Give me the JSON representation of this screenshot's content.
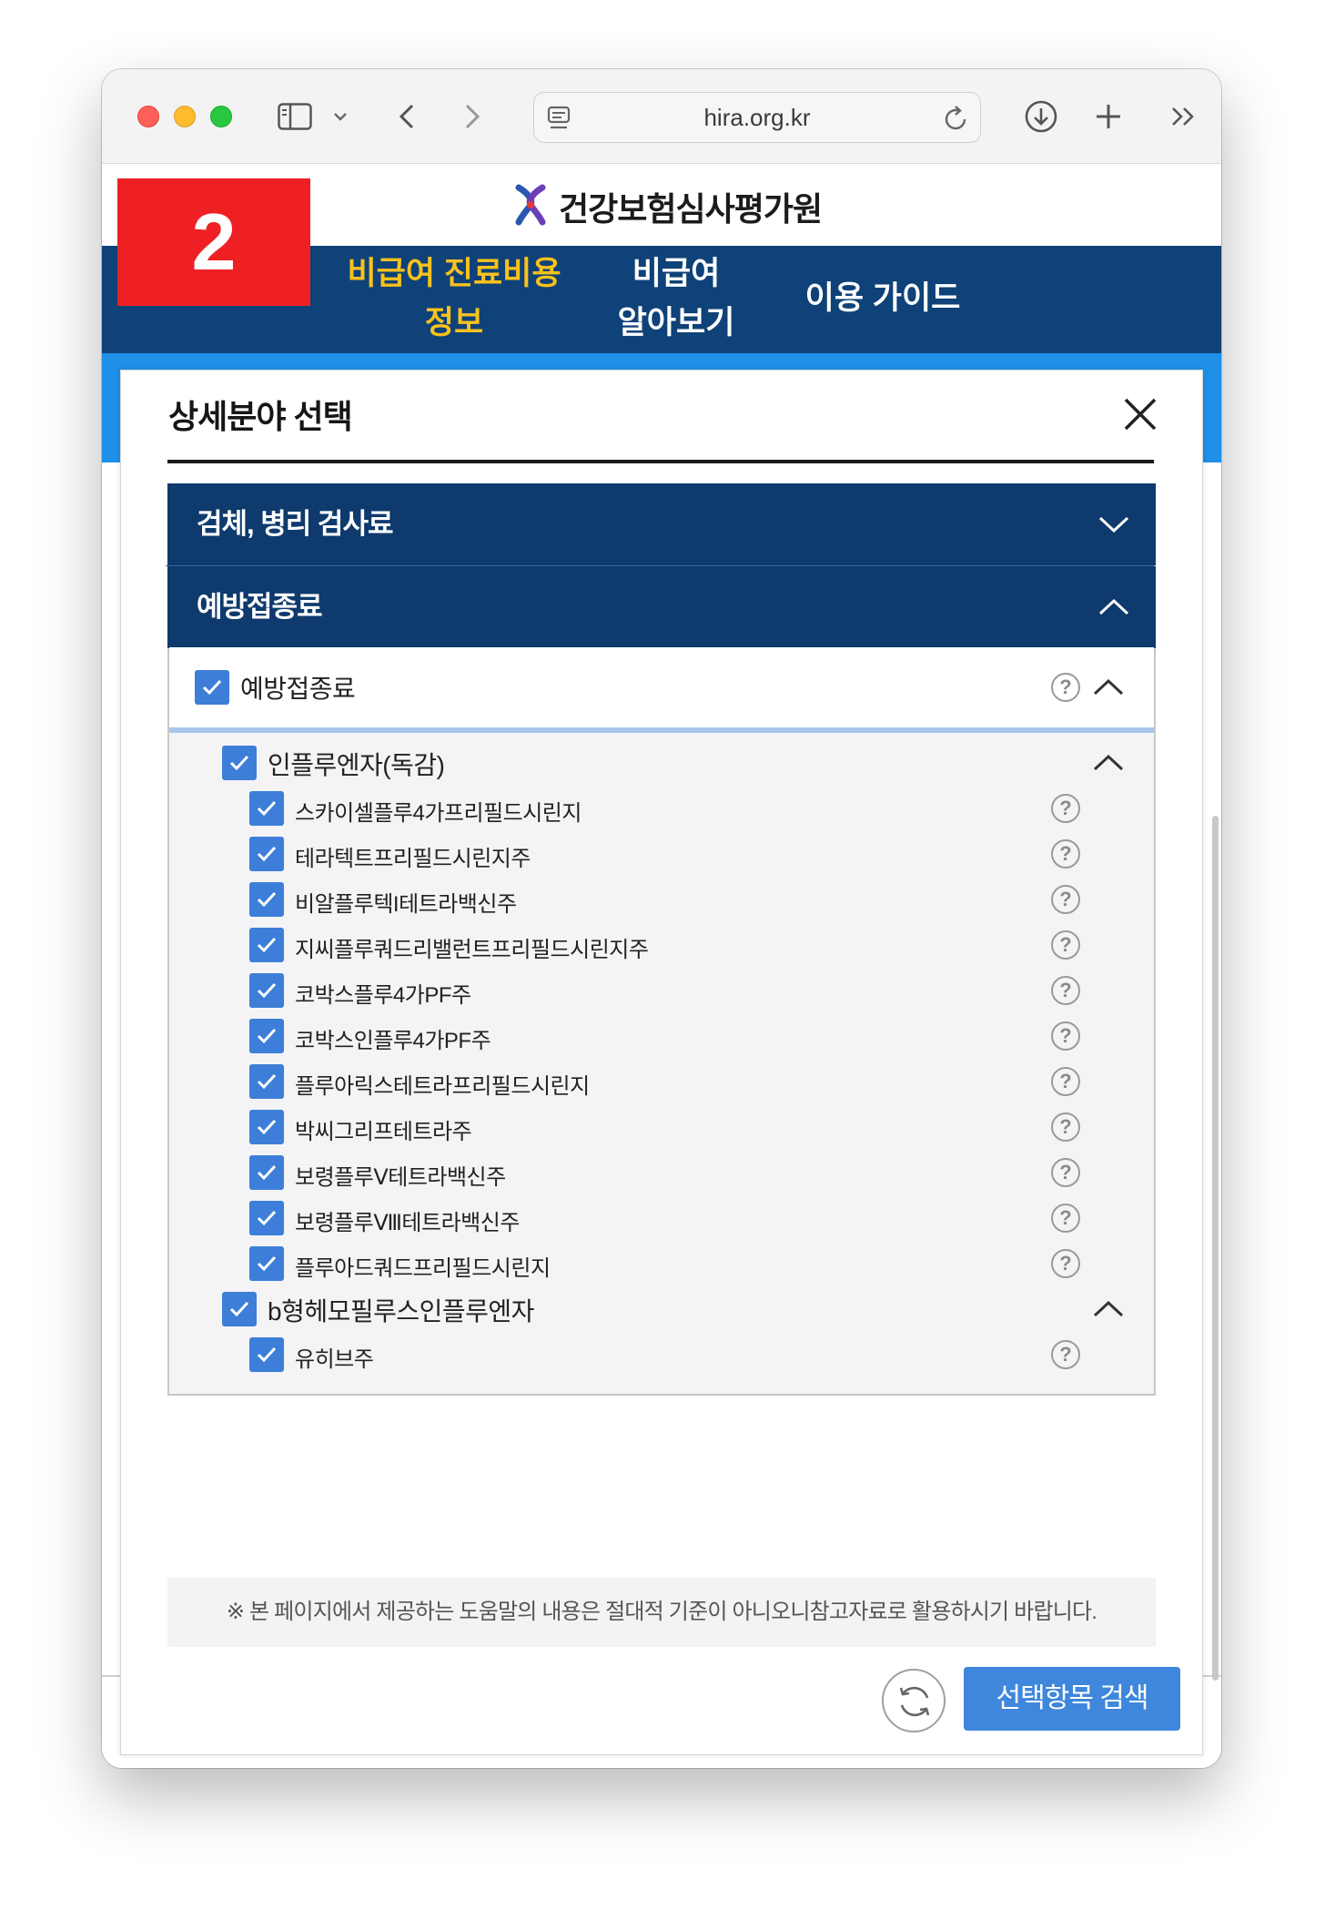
{
  "browser": {
    "url": "hira.org.kr"
  },
  "site": {
    "logo_text": "건강보험심사평가원",
    "step_badge": "2",
    "nav": [
      {
        "label": "비급여 진료비용\n정보",
        "active": true
      },
      {
        "label": "비급여\n알아보기",
        "active": false
      },
      {
        "label": "이용 가이드",
        "active": false
      }
    ]
  },
  "modal": {
    "title": "상세분야 선택",
    "categories": [
      {
        "label": "검체, 병리 검사료",
        "expanded": false
      },
      {
        "label": "예방접종료",
        "expanded": true
      }
    ],
    "level1": {
      "label": "예방접종료",
      "checked": true
    },
    "groups": [
      {
        "label": "인플루엔자(독감)",
        "checked": true,
        "items": [
          {
            "label": "스카이셀플루4가프리필드시린지",
            "checked": true
          },
          {
            "label": "테라텍트프리필드시린지주",
            "checked": true
          },
          {
            "label": "비알플루텍I테트라백신주",
            "checked": true
          },
          {
            "label": "지씨플루쿼드리밸런트프리필드시린지주",
            "checked": true
          },
          {
            "label": "코박스플루4가PF주",
            "checked": true
          },
          {
            "label": "코박스인플루4가PF주",
            "checked": true
          },
          {
            "label": "플루아릭스테트라프리필드시린지",
            "checked": true
          },
          {
            "label": "박씨그리프테트라주",
            "checked": true
          },
          {
            "label": "보령플루Ⅴ테트라백신주",
            "checked": true
          },
          {
            "label": "보령플루Ⅷ테트라백신주",
            "checked": true
          },
          {
            "label": "플루아드쿼드프리필드시린지",
            "checked": true
          }
        ]
      },
      {
        "label": "b형헤모필루스인플루엔자",
        "checked": true,
        "items": [
          {
            "label": "유히브주",
            "checked": true
          }
        ]
      }
    ],
    "help_glyph": "?",
    "notice": "※ 본 페이지에서 제공하는 도움말의 내용은 절대적 기준이 아니오니참고자료로 활용하시기 바랍니다.",
    "search_button": "선택항목 검색"
  },
  "colors": {
    "nav_bg": "#0e4278",
    "nav_active": "#f9c11d",
    "category_bg": "#0e3a6d",
    "checkbox": "#3d7ed8",
    "badge": "#ee2024",
    "search_button": "#3f87dc"
  },
  "icons": [
    "sidebar-icon",
    "chevron-down-icon",
    "back-icon",
    "forward-icon",
    "page-icon",
    "reload-icon",
    "download-icon",
    "plus-icon",
    "more-icon",
    "logo-icon",
    "close-icon",
    "check-icon",
    "help-icon",
    "chevron-up-icon",
    "refresh-icon"
  ]
}
